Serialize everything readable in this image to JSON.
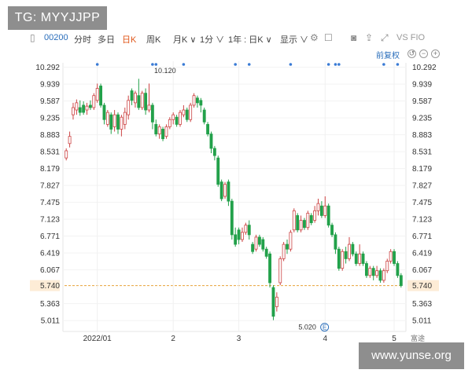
{
  "banner": {
    "text": "TG: MYYJJPP"
  },
  "watermark": {
    "text": "www.yunse.org"
  },
  "toolbar": {
    "code": "00200",
    "items": [
      "分时",
      "多日",
      "日K",
      "周K",
      "月K ∨",
      "1分 ∨",
      "1年 : 日K ∨",
      "显示 ∨"
    ],
    "active_item": "日K",
    "right_label": "VS FIO"
  },
  "adjust_button": "前复权",
  "brand_logo_text": "E",
  "brand_corner": "富途",
  "colors": {
    "up": "#cc4444",
    "down": "#22a14a",
    "last_price": "#e8a23a",
    "accent": "#e0581b"
  },
  "chart_data": {
    "type": "candlestick",
    "title": "",
    "xlabel": "",
    "ylabel": "",
    "ylim": [
      4.85,
      10.35
    ],
    "yticks": [
      "10.292",
      "9.939",
      "9.587",
      "9.235",
      "8.883",
      "8.531",
      "8.179",
      "7.827",
      "7.475",
      "7.123",
      "6.771",
      "6.419",
      "6.067",
      "5.740",
      "5.363",
      "5.011"
    ],
    "x_labels": [
      {
        "label": "2022/01",
        "index": 9
      },
      {
        "label": "2",
        "index": 31
      },
      {
        "label": "3",
        "index": 50
      },
      {
        "label": "4",
        "index": 75
      },
      {
        "label": "5",
        "index": 95
      }
    ],
    "last_price": "5.740",
    "high_label": {
      "text": "10.120",
      "index": 30
    },
    "low_label": {
      "text": "5.020",
      "index": 63
    },
    "event_markers": [
      9,
      25,
      26,
      34,
      49,
      53,
      65,
      76,
      78,
      79,
      92,
      96
    ],
    "candles": [
      [
        8.4,
        8.55,
        8.35,
        8.6
      ],
      [
        8.7,
        8.85,
        8.62,
        8.95
      ],
      [
        9.3,
        9.45,
        9.2,
        9.55
      ],
      [
        9.4,
        9.55,
        9.3,
        9.62
      ],
      [
        9.45,
        9.35,
        9.28,
        9.6
      ],
      [
        9.5,
        9.35,
        9.3,
        9.58
      ],
      [
        9.4,
        9.48,
        9.3,
        9.55
      ],
      [
        9.5,
        9.45,
        9.4,
        9.6
      ],
      [
        9.45,
        9.7,
        9.4,
        9.75
      ],
      [
        9.6,
        9.85,
        9.55,
        9.95
      ],
      [
        9.9,
        9.5,
        9.45,
        9.95
      ],
      [
        9.5,
        9.2,
        9.1,
        9.55
      ],
      [
        9.1,
        9.35,
        9.05,
        9.4
      ],
      [
        9.3,
        9.0,
        8.9,
        9.35
      ],
      [
        9.05,
        9.3,
        8.95,
        9.4
      ],
      [
        9.3,
        9.0,
        8.9,
        9.35
      ],
      [
        9.0,
        9.25,
        8.85,
        9.3
      ],
      [
        9.1,
        9.35,
        9.0,
        9.45
      ],
      [
        9.3,
        9.6,
        9.2,
        9.7
      ],
      [
        9.8,
        9.6,
        9.5,
        9.85
      ],
      [
        9.55,
        9.75,
        9.45,
        9.8
      ],
      [
        9.7,
        9.45,
        9.4,
        10.05
      ],
      [
        9.45,
        9.75,
        9.4,
        9.8
      ],
      [
        9.75,
        9.4,
        9.3,
        9.85
      ],
      [
        9.4,
        9.5,
        9.35,
        9.95
      ],
      [
        9.5,
        9.15,
        9.0,
        9.55
      ],
      [
        9.1,
        8.9,
        8.85,
        9.2
      ],
      [
        8.9,
        9.05,
        8.8,
        9.1
      ],
      [
        9.0,
        8.8,
        8.75,
        9.05
      ],
      [
        8.85,
        9.05,
        8.8,
        9.1
      ],
      [
        9.05,
        9.2,
        9.0,
        9.25
      ],
      [
        9.2,
        9.3,
        9.1,
        9.35
      ],
      [
        9.25,
        9.1,
        9.05,
        9.3
      ],
      [
        9.1,
        9.35,
        9.05,
        9.4
      ],
      [
        9.3,
        9.4,
        9.25,
        9.5
      ],
      [
        9.4,
        9.2,
        9.15,
        9.45
      ],
      [
        9.2,
        9.5,
        9.15,
        9.55
      ],
      [
        9.5,
        9.7,
        9.45,
        9.75
      ],
      [
        9.65,
        9.55,
        9.45,
        9.7
      ],
      [
        9.6,
        9.5,
        9.35,
        9.65
      ],
      [
        9.4,
        9.15,
        9.1,
        9.45
      ],
      [
        9.1,
        8.9,
        8.85,
        9.15
      ],
      [
        8.9,
        8.6,
        8.5,
        8.95
      ],
      [
        8.6,
        8.45,
        8.35,
        8.65
      ],
      [
        8.4,
        7.85,
        7.8,
        8.45
      ],
      [
        7.9,
        7.55,
        7.5,
        7.95
      ],
      [
        7.6,
        7.85,
        7.55,
        7.9
      ],
      [
        7.9,
        7.5,
        7.4,
        7.95
      ],
      [
        7.5,
        6.8,
        6.7,
        7.55
      ],
      [
        6.8,
        6.6,
        6.55,
        6.95
      ],
      [
        6.9,
        6.7,
        6.6,
        6.95
      ],
      [
        6.7,
        6.85,
        6.65,
        6.95
      ],
      [
        6.85,
        7.0,
        6.8,
        7.05
      ],
      [
        7.0,
        6.8,
        6.7,
        7.1
      ],
      [
        6.6,
        6.45,
        6.4,
        6.65
      ],
      [
        6.5,
        6.75,
        6.45,
        6.8
      ],
      [
        6.75,
        6.6,
        6.55,
        6.8
      ],
      [
        6.7,
        6.5,
        6.45,
        6.75
      ],
      [
        6.5,
        6.35,
        6.3,
        6.55
      ],
      [
        6.4,
        5.8,
        5.7,
        6.45
      ],
      [
        5.7,
        5.1,
        5.02,
        5.75
      ],
      [
        5.3,
        5.5,
        5.2,
        5.6
      ],
      [
        5.8,
        6.3,
        5.75,
        6.35
      ],
      [
        6.3,
        6.6,
        6.25,
        6.65
      ],
      [
        6.6,
        6.5,
        6.4,
        6.7
      ],
      [
        6.5,
        6.85,
        6.45,
        6.9
      ],
      [
        6.9,
        7.3,
        6.85,
        7.35
      ],
      [
        7.2,
        6.9,
        6.85,
        7.25
      ],
      [
        6.9,
        7.1,
        6.85,
        7.2
      ],
      [
        7.1,
        6.95,
        6.9,
        7.15
      ],
      [
        6.95,
        7.25,
        6.9,
        7.3
      ],
      [
        7.2,
        7.05,
        7.0,
        7.25
      ],
      [
        7.1,
        7.3,
        7.05,
        7.4
      ],
      [
        7.3,
        7.45,
        7.2,
        7.55
      ],
      [
        7.4,
        7.2,
        7.15,
        7.5
      ],
      [
        7.2,
        7.4,
        7.15,
        7.6
      ],
      [
        7.4,
        7.0,
        6.95,
        7.45
      ],
      [
        7.0,
        6.8,
        6.75,
        7.05
      ],
      [
        6.8,
        6.5,
        6.4,
        6.85
      ],
      [
        6.5,
        6.1,
        6.05,
        6.55
      ],
      [
        6.1,
        6.45,
        6.05,
        6.5
      ],
      [
        6.45,
        6.3,
        6.2,
        6.55
      ],
      [
        6.3,
        6.6,
        6.25,
        6.75
      ],
      [
        6.6,
        6.4,
        6.35,
        6.65
      ],
      [
        6.4,
        6.2,
        6.15,
        6.45
      ],
      [
        6.2,
        6.4,
        6.15,
        6.6
      ],
      [
        6.4,
        6.2,
        6.15,
        6.45
      ],
      [
        6.2,
        5.95,
        5.9,
        6.25
      ],
      [
        5.95,
        6.1,
        5.9,
        6.15
      ],
      [
        6.1,
        5.95,
        5.85,
        6.15
      ],
      [
        5.95,
        6.05,
        5.9,
        6.15
      ],
      [
        6.05,
        5.85,
        5.8,
        6.1
      ],
      [
        5.85,
        6.05,
        5.8,
        6.1
      ],
      [
        6.05,
        6.25,
        6.0,
        6.3
      ],
      [
        6.25,
        6.45,
        6.2,
        6.5
      ],
      [
        6.45,
        6.2,
        6.15,
        6.5
      ],
      [
        6.2,
        5.95,
        5.9,
        6.25
      ],
      [
        5.95,
        5.74,
        5.7,
        6.0
      ]
    ]
  }
}
